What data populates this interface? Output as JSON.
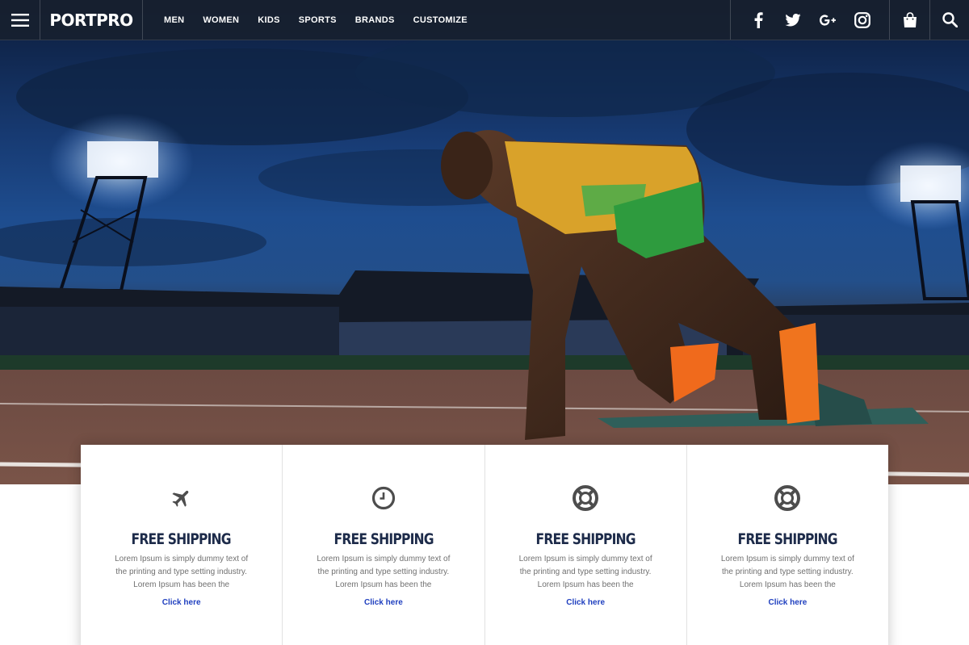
{
  "brand": {
    "logo": "PORTPRO"
  },
  "nav": {
    "menu": [
      "MEN",
      "WOMEN",
      "KIDS",
      "SPORTS",
      "BRANDS",
      "CUSTOMIZE"
    ],
    "socials": [
      "facebook-icon",
      "twitter-icon",
      "google-plus-icon",
      "instagram-icon"
    ],
    "cart_icon": "shopping-bag-icon",
    "search_icon": "search-icon"
  },
  "hero": {
    "image": "sprinter-in-starting-blocks-stadium"
  },
  "features": [
    {
      "icon": "airplane-icon",
      "title": "FREE SHIPPING",
      "text": "Lorem Ipsum is simply dummy text of the printing and type setting industry. Lorem Ipsum has been the",
      "link": "Click here"
    },
    {
      "icon": "clock-icon",
      "title": "FREE SHIPPING",
      "text": "Lorem Ipsum is simply dummy text of the printing and type setting industry. Lorem Ipsum has been the",
      "link": "Click here"
    },
    {
      "icon": "lifebuoy-icon",
      "title": "FREE SHIPPING",
      "text": "Lorem Ipsum is simply dummy text of the printing and type setting industry. Lorem Ipsum has been the",
      "link": "Click here"
    },
    {
      "icon": "lifebuoy-icon",
      "title": "FREE SHIPPING",
      "text": "Lorem Ipsum is simply dummy text of the printing and type setting industry. Lorem Ipsum has been the",
      "link": "Click here"
    }
  ],
  "colors": {
    "title": "#1d2b4a",
    "link": "#1f3fbf",
    "nav_bg": "#18202e"
  }
}
